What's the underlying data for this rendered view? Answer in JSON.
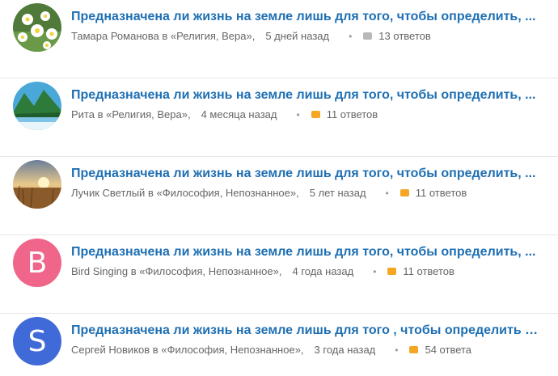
{
  "questions": [
    {
      "title": "Предназначена ли жизнь на земле лишь для того, чтобы определить, ...",
      "author": "Тамара Романова",
      "category": "Религия, Вера",
      "age": "5 дней назад",
      "answers": "13 ответов",
      "bubble_color": "grey",
      "avatar": {
        "type": "image",
        "icon": "daisy-flowers-photo"
      }
    },
    {
      "title": "Предназначена ли жизнь на земле лишь для того, чтобы определить, ...",
      "author": "Рита",
      "category": "Религия, Вера",
      "age": "4 месяца назад",
      "answers": "11 ответов",
      "bubble_color": "orange",
      "avatar": {
        "type": "image",
        "icon": "mountain-lake-photo"
      }
    },
    {
      "title": "Предназначена ли жизнь на земле лишь для того, чтобы определить, ...",
      "author": "Лучик Светлый",
      "category": "Философия, Непознанное",
      "age": "5 лет назад",
      "answers": "11 ответов",
      "bubble_color": "orange",
      "avatar": {
        "type": "image",
        "icon": "sunset-field-photo"
      }
    },
    {
      "title": "Предназначена ли жизнь на земле лишь для того, чтобы определить, ...",
      "author": "Bird Singing",
      "category": "Философия, Непознанное",
      "age": "4 года назад",
      "answers": "11 ответов",
      "bubble_color": "orange",
      "avatar": {
        "type": "letter",
        "letter": "B",
        "color": "#f0658a"
      }
    },
    {
      "title": "Предназначена ли жизнь на земле лишь для того , чтобы определить , ...",
      "author": "Сергей Новиков",
      "category": "Философия, Непознанное",
      "age": "3 года назад",
      "answers": "54 ответа",
      "bubble_color": "orange",
      "avatar": {
        "type": "letter",
        "letter": "S",
        "color": "#3f6ad8"
      }
    }
  ],
  "ui": {
    "in_word": "в",
    "quote_open": "«",
    "quote_close": "»,",
    "separator": "•"
  },
  "colors": {
    "title": "#1e6fb3",
    "meta": "#666666",
    "bubble_grey": "#b8b8b8",
    "bubble_orange": "#f5a623"
  }
}
